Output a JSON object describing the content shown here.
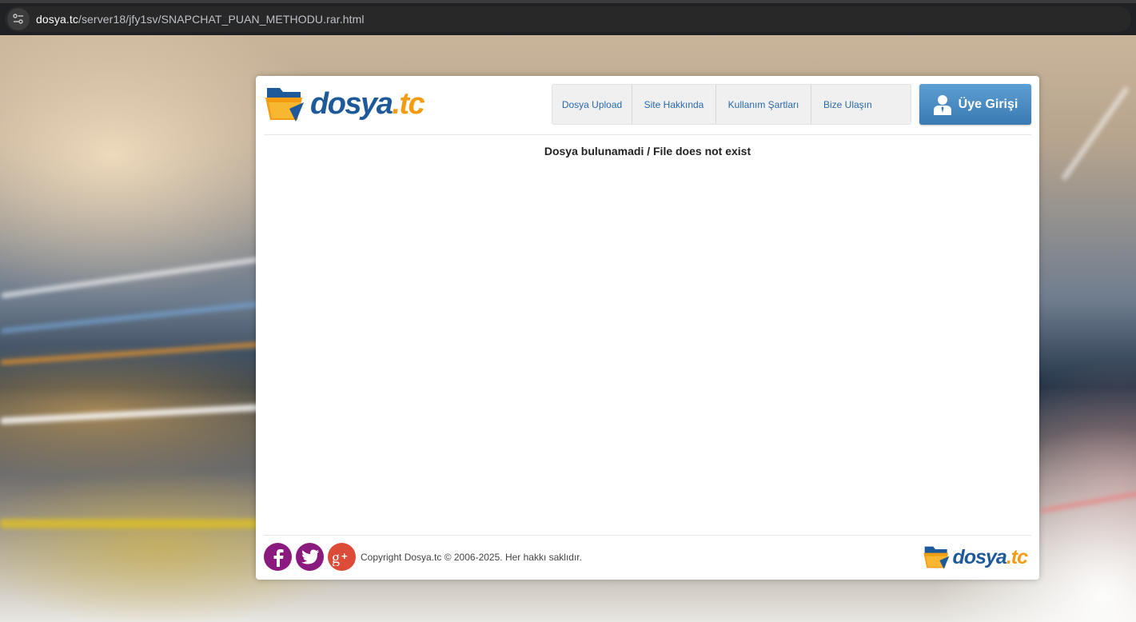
{
  "browser": {
    "url_domain": "dosya.tc",
    "url_path": "/server18/jfy1sv/SNAPCHAT_PUAN_METHODU.rar.html"
  },
  "header": {
    "logo": {
      "part1": "dosya",
      "part2": ".tc"
    },
    "nav": [
      {
        "label": "Dosya Upload"
      },
      {
        "label": "Site Hakkında"
      },
      {
        "label": "Kullanım Şartları"
      },
      {
        "label": "Bize Ulaşın"
      }
    ],
    "login_label": "Üye Girişi"
  },
  "main": {
    "message": "Dosya bulunamadi / File does not exist"
  },
  "footer": {
    "copyright": "Copyright Dosya.tc © 2006-2025. Her hakkı saklıdır.",
    "logo": {
      "part1": "dosya",
      "part2": ".tc"
    },
    "social": [
      {
        "icon": "facebook-icon",
        "color": "#8a1a7e"
      },
      {
        "icon": "twitter-icon",
        "color": "#8a1a7e"
      },
      {
        "icon": "google-plus-icon",
        "color": "#dc4a38"
      }
    ]
  },
  "colors": {
    "brand_blue": "#1e5a9a",
    "brand_orange": "#f39c12",
    "nav_link": "#2a6aa8",
    "login_button": "#4a8cc4"
  }
}
